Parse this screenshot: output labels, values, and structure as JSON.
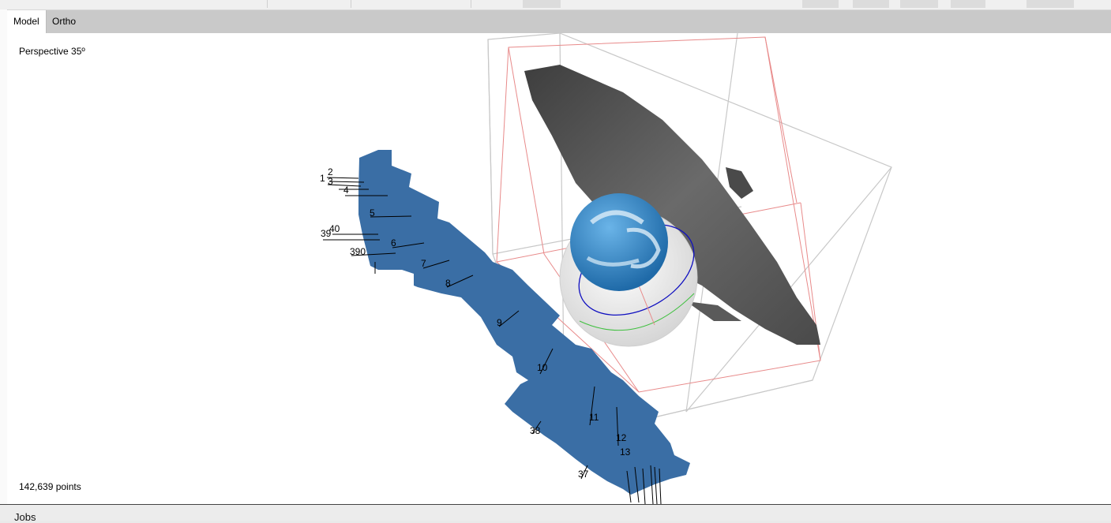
{
  "tabs": [
    {
      "label": "Model",
      "active": true
    },
    {
      "label": "Ortho",
      "active": false
    }
  ],
  "viewport": {
    "projection_label": "Perspective 35º",
    "point_count_label": "142,639 points"
  },
  "bottom_panel": {
    "label": "Jobs"
  },
  "cameras": {
    "labels": [
      "1",
      "2",
      "3",
      "4",
      "5",
      "39",
      "40",
      "6",
      "390",
      "7",
      "8",
      "9",
      "10",
      "11",
      "12",
      "13",
      "38",
      "37"
    ]
  },
  "colors": {
    "tab_bar": "#c9c9c9",
    "camera_plane": "#3a6ea5",
    "point_cloud": "#5a5a5a",
    "bounding_box_red": "#e88a8a",
    "bounding_box_gray": "#c8c8c8",
    "gizmo_blue": "#1010c0",
    "gizmo_green": "#40c040",
    "ball": "#3a86c8"
  }
}
